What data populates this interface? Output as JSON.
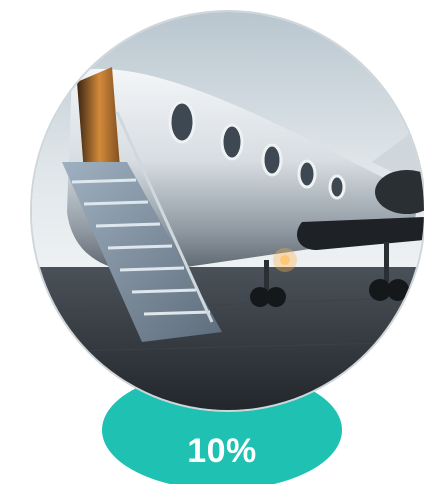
{
  "promo": {
    "discount_label": "10%"
  },
  "photo": {
    "subject_icon": "private-jet-icon"
  },
  "colors": {
    "badge": "#1fc1b2",
    "badge_text": "#ffffff",
    "sky": "#c9d4da",
    "tarmac": "#2b3036"
  }
}
